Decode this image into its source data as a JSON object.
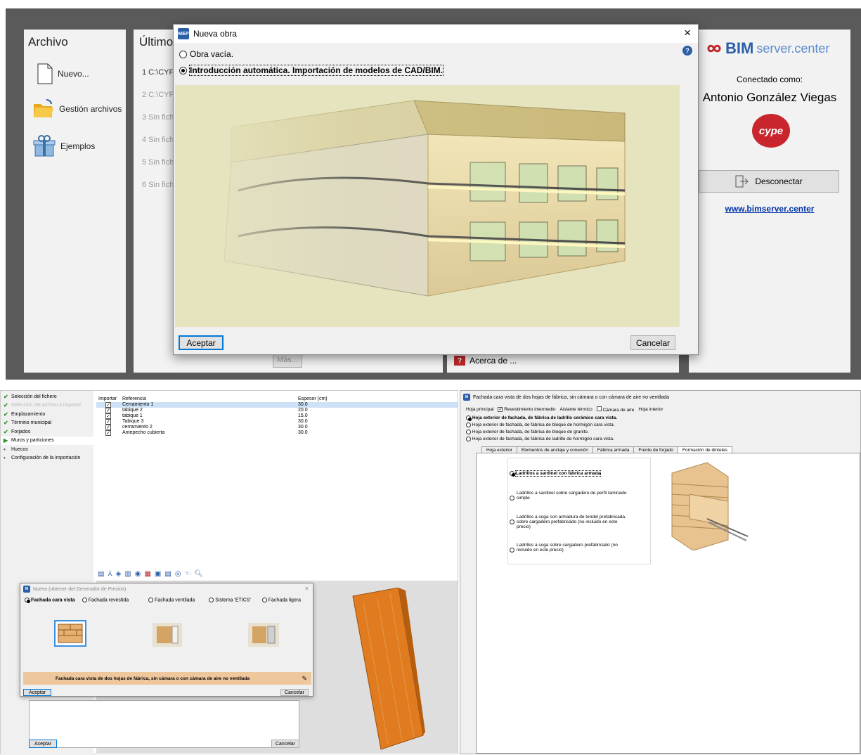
{
  "start": {
    "file_panel": {
      "title": "Archivo",
      "items": [
        {
          "label": "Nuevo...",
          "icon": "new-file-icon"
        },
        {
          "label": "Gestión archivos",
          "icon": "folder-icon"
        },
        {
          "label": "Ejemplos",
          "icon": "gift-box-icon"
        }
      ]
    },
    "recent_panel": {
      "title": "Último",
      "items": [
        "1 C:\\CYF",
        "2 C:\\CYF",
        "3 Sin fich",
        "4 Sin fich",
        "5 Sin fich",
        "6 Sin fich"
      ],
      "more": "Más..."
    },
    "about": {
      "label": "Acerca de ..."
    },
    "bim": {
      "brand_bold": "BIM",
      "brand_light": "server.center",
      "connected_label": "Conectado como:",
      "user": "Antonio González Viegas",
      "cype": "cype",
      "disconnect": "Desconectar",
      "link": "www.bimserver.center"
    }
  },
  "dialog": {
    "title": "Nueva obra",
    "close": "×",
    "help": "?",
    "options": [
      "Obra vacía.",
      "Introducción automática. Importación de modelos de CAD/BIM."
    ],
    "selected": 1,
    "accept": "Aceptar",
    "cancel": "Cancelar"
  },
  "importer": {
    "steps": [
      {
        "label": "Selección del fichero",
        "state": "done"
      },
      {
        "label": "Selección del archivo a importar",
        "state": "disabled"
      },
      {
        "label": "Emplazamiento",
        "state": "done"
      },
      {
        "label": "Término municipal",
        "state": "done"
      },
      {
        "label": "Forjados",
        "state": "done"
      },
      {
        "label": "Muros y particiones",
        "state": "current"
      },
      {
        "label": "Huecos",
        "state": "pending"
      },
      {
        "label": "Configuración de la importación",
        "state": "pending"
      }
    ],
    "columns": [
      "Importar",
      "Referencia",
      "Espesor (cm)"
    ],
    "rows": [
      {
        "ref": "Cerramiento 1",
        "thk": "30.0"
      },
      {
        "ref": "tabique 2",
        "thk": "20.0"
      },
      {
        "ref": "tabique 1",
        "thk": "15.0"
      },
      {
        "ref": "Tabique 3",
        "thk": "30.0"
      },
      {
        "ref": "cerramiento 2",
        "thk": "30.0"
      },
      {
        "ref": "Antepecho cubierta",
        "thk": "30.0"
      }
    ],
    "accept": "Aceptar",
    "cancel": "Cancelar"
  },
  "generator": {
    "title": "Nuevo (obtener del Generador de Precios)",
    "close": "×",
    "options": [
      "Fachada cara vista",
      "Fachada revestida",
      "Fachada ventilada",
      "Sistema 'ETICS'",
      "Fachada ligera"
    ],
    "selected": 0,
    "description": "Fachada cara vista de dos hojas de fábrica, sin cámara o con cámara de aire no ventilada",
    "accept": "Aceptar",
    "cancel": "Cancelar"
  },
  "facade": {
    "title": "Fachada cara vista de dos hojas de fábrica, sin cámara o con cámara de aire no ventilada",
    "tabs": [
      "Hoja principal",
      "Revestimiento intermedio",
      "Aislante térmico",
      "Cámara de aire",
      "Hoja interior"
    ],
    "options": [
      "Hoja exterior de fachada, de fábrica de ladrillo cerámico cara vista.",
      "Hoja exterior de fachada, de fábrica de bloque de hormigón cara vista.",
      "Hoja exterior de fachada, de fábrica de bloque de granito.",
      "Hoja exterior de fachada, de fábrica de ladrillo de hormigón cara vista."
    ],
    "subtabs": [
      "Hoja exterior",
      "Elementos de anclaje y conexión",
      "Fábrica armada",
      "Frente de forjado",
      "Formación de dinteles"
    ],
    "lintels": [
      "Ladrillos a sardinel con fábrica armada",
      "Ladrillos a sardinel sobre cargadero de perfil laminado simple",
      "Ladrillos a soga con armadura de tendel prefabricada, sobre cargadero prefabricado (no incluido en este precio)",
      "Ladrillos a soga sobre cargadero prefabricado (no incluido en este precio)"
    ]
  }
}
